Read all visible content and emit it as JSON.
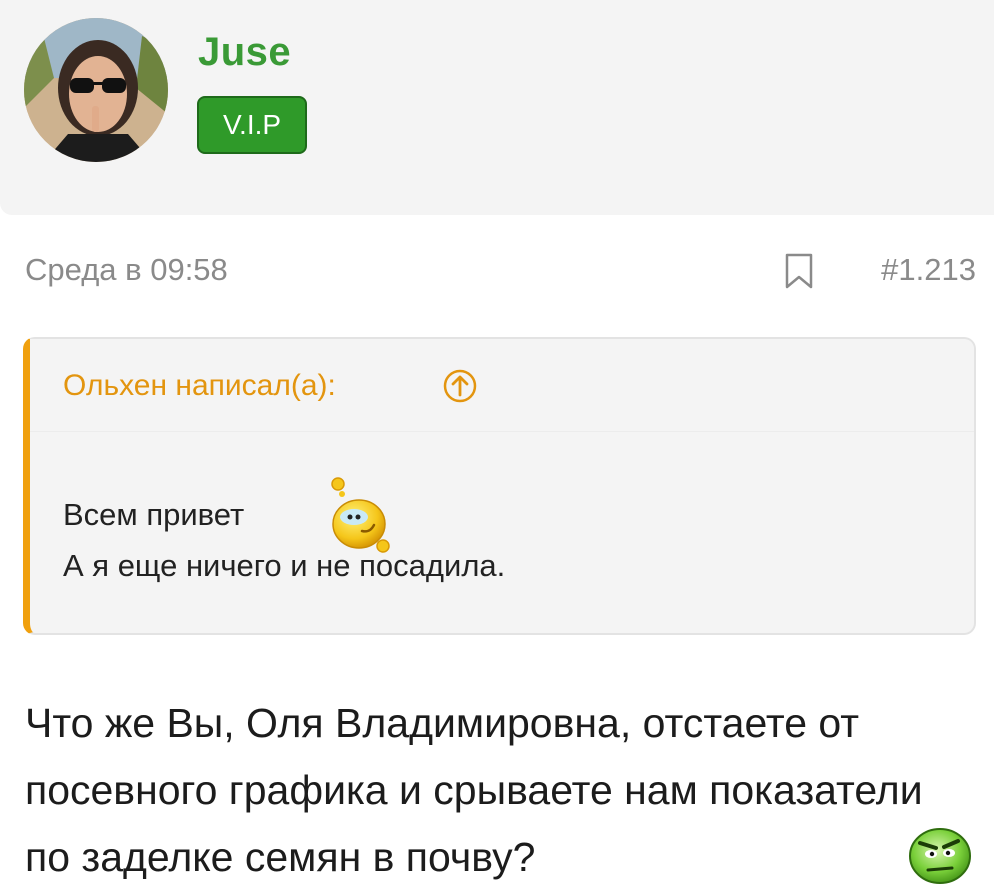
{
  "user": {
    "name": "Juse",
    "badge": "V.I.P"
  },
  "post": {
    "date": "Среда в 09:58",
    "number": "#1.213",
    "quote": {
      "author_line": "Ольхен написал(а):",
      "line1": "Всем привет",
      "line2": "А я еще ничего и не посадила."
    },
    "text": "Что же Вы, Оля Владимировна, отстаете от посевного графика и срываете нам показатели по заделке семян в почву?"
  },
  "icons": {
    "bookmark": "bookmark-icon",
    "quote_jump": "arrow-up-circle-icon",
    "smiley_1": "winking-smiley-icon",
    "smiley_2": "frowning-smiley-icon"
  },
  "colors": {
    "username": "#3a9a36",
    "badge_bg": "#2f9a29",
    "quote_accent": "#f0a00e",
    "meta_text": "#8a8a8a"
  }
}
